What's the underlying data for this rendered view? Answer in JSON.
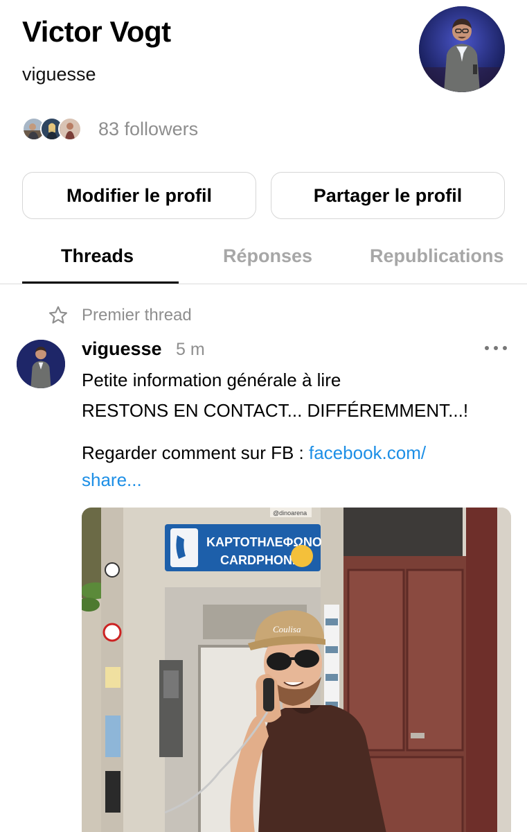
{
  "profile": {
    "name": "Victor Vogt",
    "handle": "viguesse",
    "followers_text": "83 followers"
  },
  "actions": {
    "edit_label": "Modifier le profil",
    "share_label": "Partager le profil"
  },
  "tabs": [
    {
      "label": "Threads",
      "active": true
    },
    {
      "label": "Réponses",
      "active": false
    },
    {
      "label": "Republications",
      "active": false
    }
  ],
  "post": {
    "pinned_label": "Premier thread",
    "username": "viguesse",
    "time": "5 m",
    "lines": [
      "Petite information générale à lire",
      "RESTONS EN CONTACT... DIFFÉREMMENT...!"
    ],
    "link_prefix": "Regarder comment sur FB : ",
    "link_text_line1": "facebook.com/",
    "link_text_line2": "share...",
    "image": {
      "sign_greek": "ΚΑΡΤΟΤΗΛΕΦΩΝΟ",
      "sign_english": "CARDPHONE",
      "cap_text": "Coulisa",
      "sticker_text": "@dinoarena"
    }
  },
  "icons": {
    "pinned": "star-icon",
    "more": "more-icon"
  },
  "colors": {
    "link": "#1d8fe6",
    "muted": "#8e8e8e",
    "inactive_tab": "#a7a7a7",
    "border": "#d6d6d6"
  }
}
